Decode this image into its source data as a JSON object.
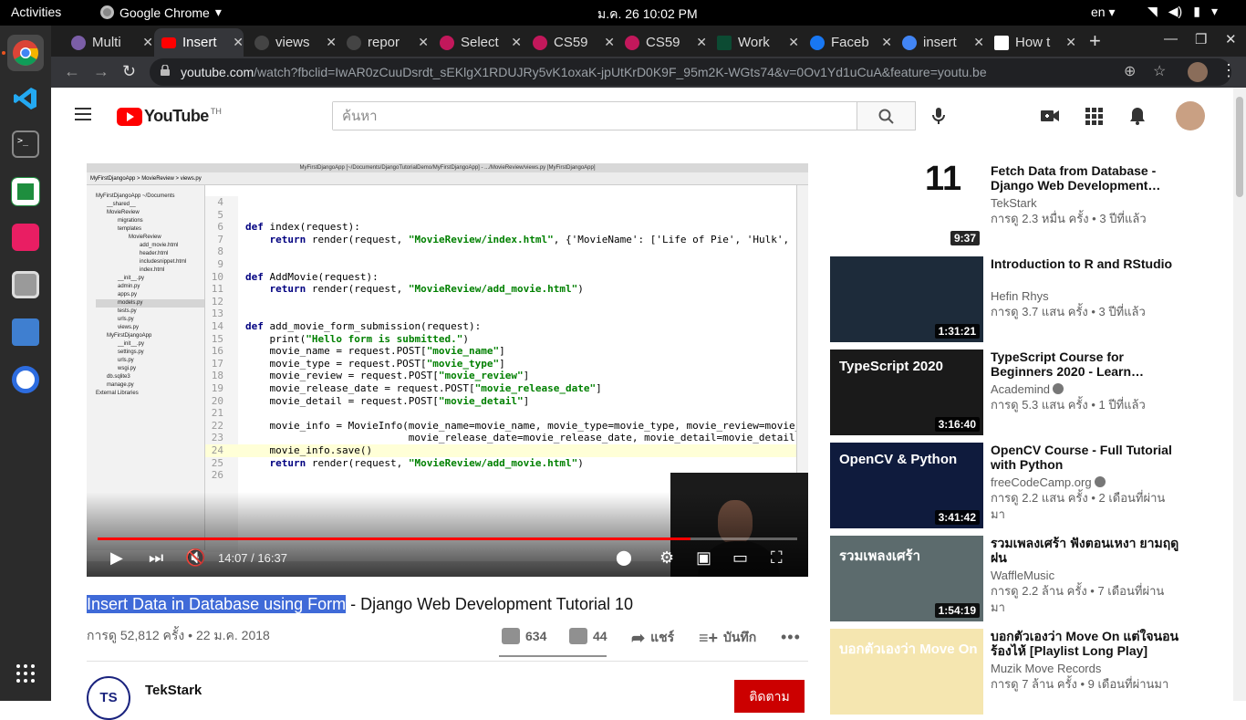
{
  "topbar": {
    "activities": "Activities",
    "app_name": "Google Chrome",
    "clock": "ม.ค. 26  10:02 PM",
    "language": "en"
  },
  "tabs": [
    {
      "title": "Multi",
      "favicon_color": "#7b5ea7"
    },
    {
      "title": "Insert",
      "favicon_color": "#ff0000"
    },
    {
      "title": "views",
      "favicon_color": "#444444"
    },
    {
      "title": "repor",
      "favicon_color": "#444444"
    },
    {
      "title": "Select",
      "favicon_color": "#c2185b"
    },
    {
      "title": "CS59",
      "favicon_color": "#c2185b"
    },
    {
      "title": "CS59",
      "favicon_color": "#c2185b"
    },
    {
      "title": "Work",
      "favicon_color": "#0c4b33"
    },
    {
      "title": "Faceb",
      "favicon_color": "#1877f2"
    },
    {
      "title": "insert",
      "favicon_color": "#4285f4"
    },
    {
      "title": "How t",
      "favicon_color": "#ffffff"
    }
  ],
  "omnibox": {
    "url_host": "youtube.com",
    "url_path": "/watch?fbclid=IwAR0zCuuDsrdt_sEKlgX1RDUJRy5vK1oxaK-jpUtKrD0K9F_95m2K-WGts74&v=0Ov1Yd1uCuA&feature=youtu.be"
  },
  "youtube": {
    "logo_text": "YouTube",
    "region": "TH",
    "search_placeholder": "ค้นหา"
  },
  "player": {
    "ide_title": "MyFirstDjangoApp [~/Documents/DjangoTutorialDemo/MyFirstDjangoApp] - .../MovieReview/views.py [MyFirstDjangoApp]",
    "ide_breadcrumb": "MyFirstDjangoApp  >  MovieReview  >  views.py",
    "tree": [
      "MyFirstDjangoApp ~/Documents",
      "__shared__",
      "MovieReview",
      "migrations",
      "templates",
      "MovieReview",
      "add_movie.html",
      "header.html",
      "includesnippet.html",
      "index.html",
      "__init__.py",
      "admin.py",
      "apps.py",
      "models.py",
      "tests.py",
      "urls.py",
      "views.py",
      "MyFirstDjangoApp",
      "__init__.py",
      "settings.py",
      "urls.py",
      "wsgi.py",
      "db.sqlite3",
      "manage.py",
      "External Libraries"
    ],
    "code_lines": [
      {
        "n": "4",
        "text": ""
      },
      {
        "n": "5",
        "text": ""
      },
      {
        "n": "6",
        "text": "def index(request):"
      },
      {
        "n": "7",
        "text": "    return render(request, \"MovieReview/index.html\", {'MovieName': ['Life of Pie', 'Hulk',"
      },
      {
        "n": "8",
        "text": ""
      },
      {
        "n": "9",
        "text": ""
      },
      {
        "n": "10",
        "text": "def AddMovie(request):"
      },
      {
        "n": "11",
        "text": "    return render(request, \"MovieReview/add_movie.html\")"
      },
      {
        "n": "12",
        "text": ""
      },
      {
        "n": "13",
        "text": ""
      },
      {
        "n": "14",
        "text": "def add_movie_form_submission(request):"
      },
      {
        "n": "15",
        "text": "    print(\"Hello form is submitted.\")"
      },
      {
        "n": "16",
        "text": "    movie_name = request.POST[\"movie_name\"]"
      },
      {
        "n": "17",
        "text": "    movie_type = request.POST[\"movie_type\"]"
      },
      {
        "n": "18",
        "text": "    movie_review = request.POST[\"movie_review\"]"
      },
      {
        "n": "19",
        "text": "    movie_release_date = request.POST[\"movie_release_date\"]"
      },
      {
        "n": "20",
        "text": "    movie_detail = request.POST[\"movie_detail\"]"
      },
      {
        "n": "21",
        "text": ""
      },
      {
        "n": "22",
        "text": "    movie_info = MovieInfo(movie_name=movie_name, movie_type=movie_type, movie_review=movie_"
      },
      {
        "n": "23",
        "text": "                           movie_release_date=movie_release_date, movie_detail=movie_detail)"
      },
      {
        "n": "24",
        "text": "    movie_info.save()"
      },
      {
        "n": "25",
        "text": "    return render(request, \"MovieReview/add_movie.html\")"
      },
      {
        "n": "26",
        "text": ""
      }
    ],
    "current_time": "14:07",
    "duration": "16:37",
    "progress_fraction": 0.847
  },
  "video": {
    "title_selected": "Insert Data in Database using Form",
    "title_rest": " - Django Web Development Tutorial 10",
    "views_date": "การดู 52,812 ครั้ง • 22 ม.ค. 2018",
    "likes": "634",
    "dislikes": "44",
    "share": "แชร์",
    "save": "บันทึก",
    "channel": "TekStark",
    "channel_initials": "TS",
    "subscribe": "ติดตาม"
  },
  "recommendations": [
    {
      "title": "Fetch Data from Database - Django Web Development…",
      "channel": "TekStark",
      "verified": false,
      "meta": "การดู 2.3 หมื่น ครั้ง • 3 ปีที่แล้ว",
      "duration": "9:37",
      "thumb_color": "#ffffff",
      "thumb_text": "11"
    },
    {
      "title": "Introduction to R and RStudio",
      "channel": "Hefin Rhys",
      "verified": false,
      "meta": "การดู 3.7 แสน ครั้ง • 3 ปีที่แล้ว",
      "duration": "1:31:21",
      "thumb_color": "#1d2b3a",
      "thumb_text": ""
    },
    {
      "title": "TypeScript Course for Beginners 2020 - Learn…",
      "channel": "Academind",
      "verified": true,
      "meta": "การดู 5.3 แสน ครั้ง • 1 ปีที่แล้ว",
      "duration": "3:16:40",
      "thumb_color": "#1a1a1a",
      "thumb_text": "TypeScript 2020"
    },
    {
      "title": "OpenCV Course - Full Tutorial with Python",
      "channel": "freeCodeCamp.org",
      "verified": true,
      "meta": "การดู 2.2 แสน ครั้ง • 2 เดือนที่ผ่านมา",
      "duration": "3:41:42",
      "thumb_color": "#0f1b3d",
      "thumb_text": "OpenCV & Python"
    },
    {
      "title": "รวมเพลงเศร้า ฟังตอนเหงา ยามฤดูฝน",
      "channel": "WaffleMusic",
      "verified": false,
      "meta": "การดู 2.2 ล้าน ครั้ง • 7 เดือนที่ผ่านมา",
      "duration": "1:54:19",
      "thumb_color": "#5c6b6d",
      "thumb_text": "รวมเพลงเศร้า"
    },
    {
      "title": "บอกตัวเองว่า Move On แต่ใจนอนร้องไห้ [Playlist Long Play]",
      "channel": "Muzik Move Records",
      "verified": false,
      "meta": "การดู 7 ล้าน ครั้ง • 9 เดือนที่ผ่านมา",
      "duration": "",
      "thumb_color": "#f5e6b0",
      "thumb_text": "บอกตัวเองว่า Move On"
    }
  ]
}
